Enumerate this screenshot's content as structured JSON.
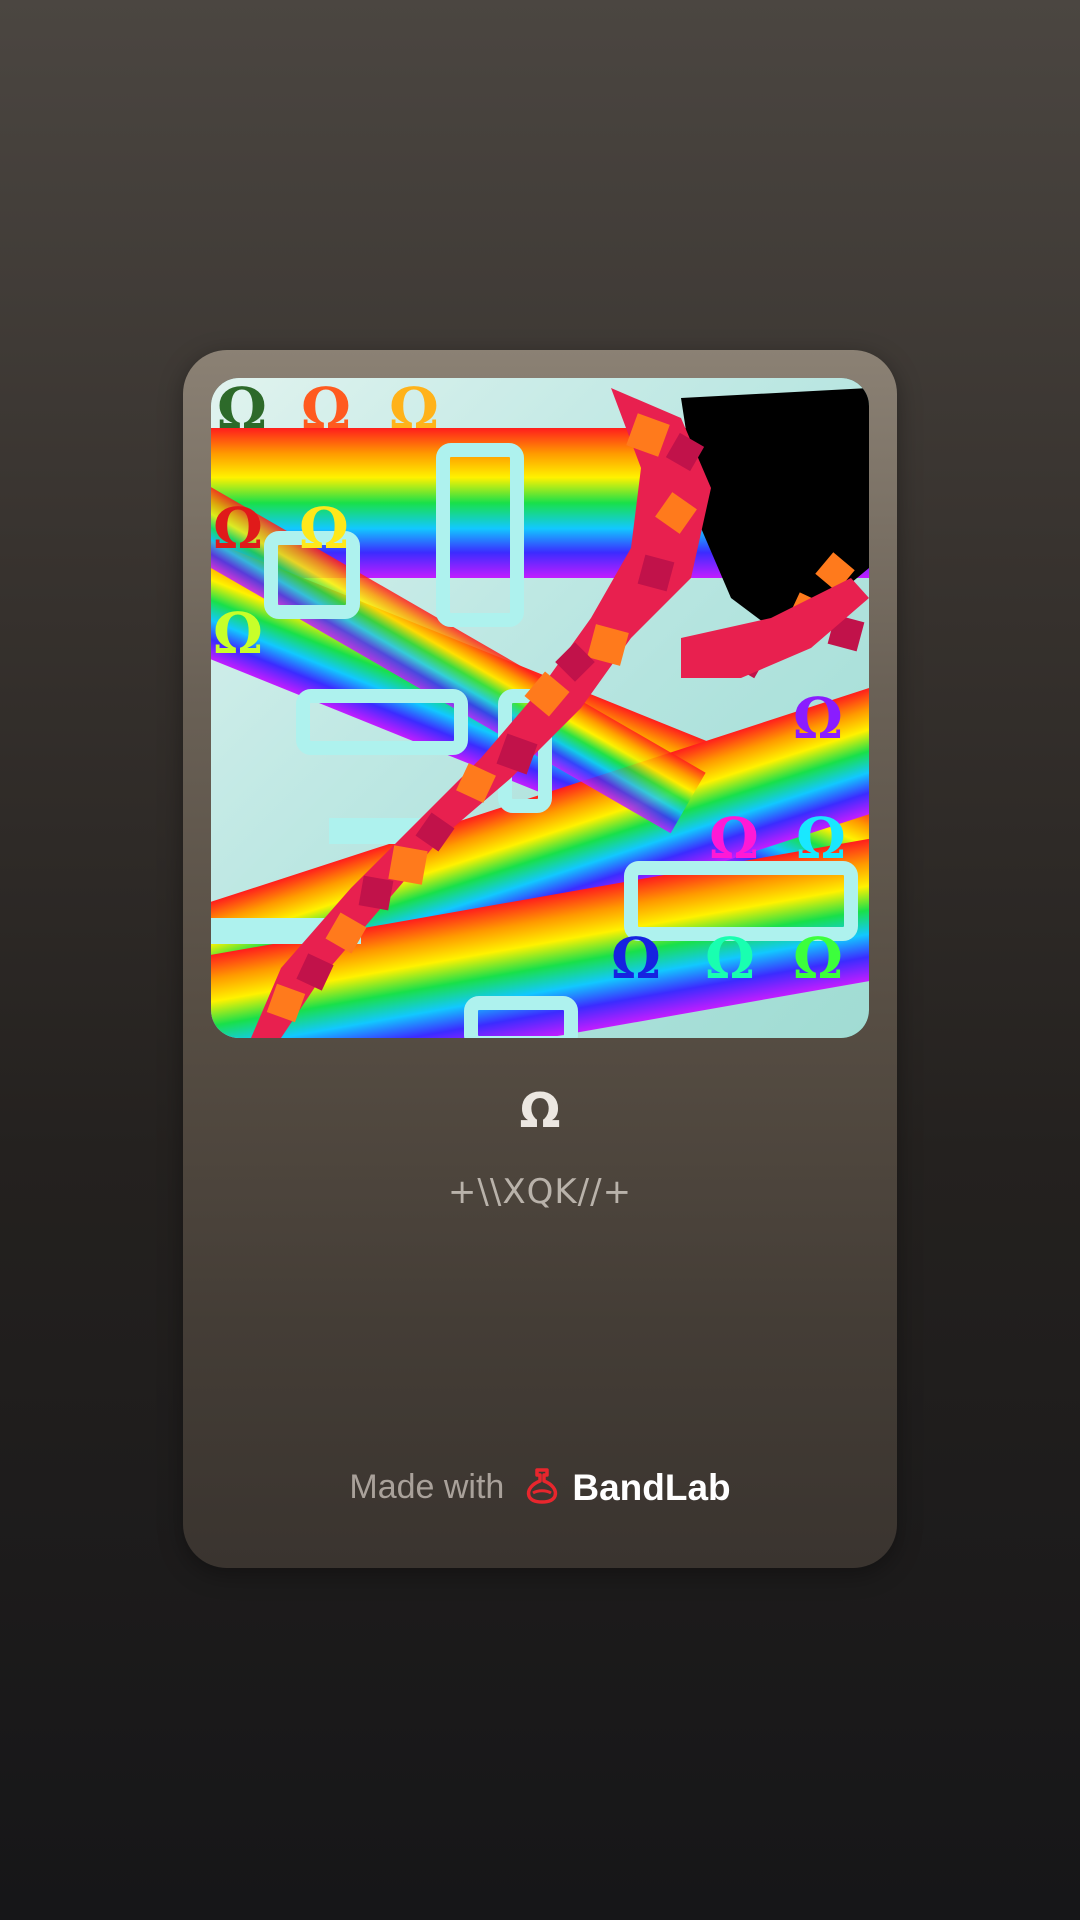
{
  "card": {
    "title": "Ω",
    "artist": "+\\\\XQK//+",
    "footer": {
      "made_with_label": "Made with",
      "brand_name": "BandLab",
      "brand_icon": "bandlab-flask-icon",
      "brand_color": "#e8262d"
    },
    "artwork_icon": "cover-artwork"
  }
}
